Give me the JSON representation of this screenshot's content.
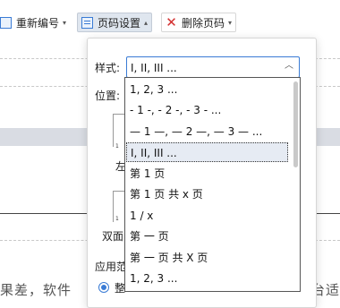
{
  "toolbar": {
    "renumber_label": "重新编号",
    "page_settings_label": "页码设置",
    "delete_page_number_label": "删除页码"
  },
  "panel": {
    "style_label": "样式:",
    "style_value": "I, II, III ...",
    "position_label": "位置:",
    "left_label": "左",
    "double_label": "双面",
    "apply_label": "应用范",
    "apply_option": "整"
  },
  "dropdown": {
    "options": [
      "1, 2, 3 ...",
      "- 1 -, - 2 -, - 3 - ...",
      "— 1 —, — 2 —, — 3 — ...",
      "I, II, III ...",
      "第 1 页",
      "第 1 页 共 x 页",
      "1 / x",
      "第 一 页",
      "第 一 页 共 X 页",
      "1, 2, 3 ..."
    ],
    "selected_index": 3
  },
  "document": {
    "text_left": "果差，软件",
    "text_right": "台适"
  },
  "colors": {
    "accent": "#3a7bd5",
    "delete_icon": "#d32f2f"
  }
}
